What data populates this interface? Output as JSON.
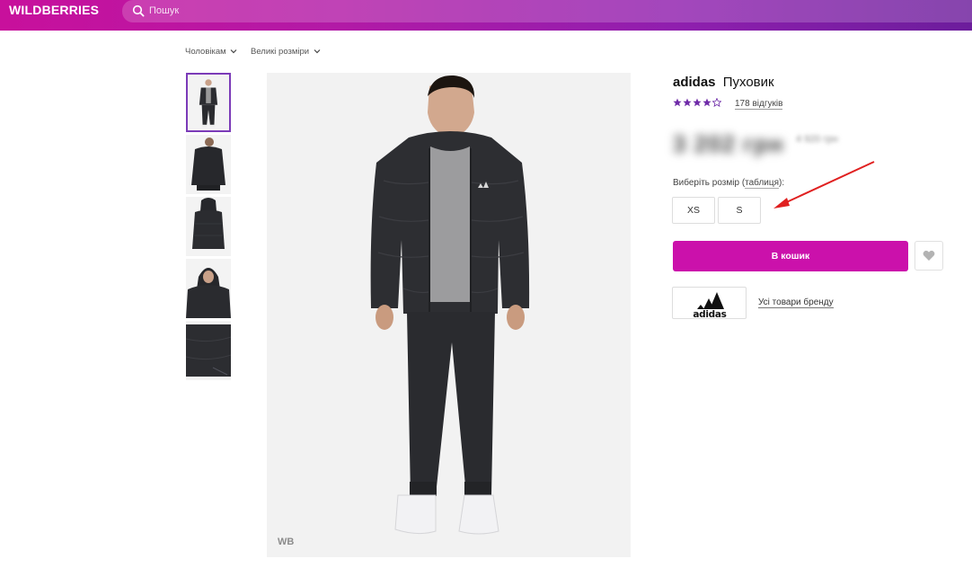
{
  "header": {
    "logo": "WILDBERRIES",
    "search_placeholder": "Пошук",
    "colors": {
      "gradient_start": "#c8109c",
      "gradient_end": "#6c1d9c"
    }
  },
  "breadcrumb": {
    "menus": [
      "Чоловікам",
      "Великі розміри"
    ]
  },
  "gallery": {
    "thumbnail_count": 5,
    "active_index": 0,
    "watermark": "WB"
  },
  "product": {
    "brand": "adidas",
    "name": "Пуховик",
    "rating": 4,
    "rating_max": 5,
    "reviews": "178 відгуків",
    "price": "3 202 грн",
    "old_price": "4 920 грн",
    "size_label_prefix": "Виберіть розмір (",
    "size_table_link": "таблиця",
    "size_label_suffix": "):",
    "sizes": [
      "XS",
      "S"
    ],
    "add_to_cart": "В кошик",
    "all_brand_goods": "Усі товари бренду",
    "brand_logo_text": "adidas"
  },
  "colors": {
    "accent": "#cb11ab",
    "star": "#6e2aa8",
    "annotation_arrow": "#e02020"
  },
  "icons": {
    "search": "search-icon",
    "chevron": "chevron-down-icon",
    "heart": "heart-icon",
    "star": "star-icon"
  }
}
